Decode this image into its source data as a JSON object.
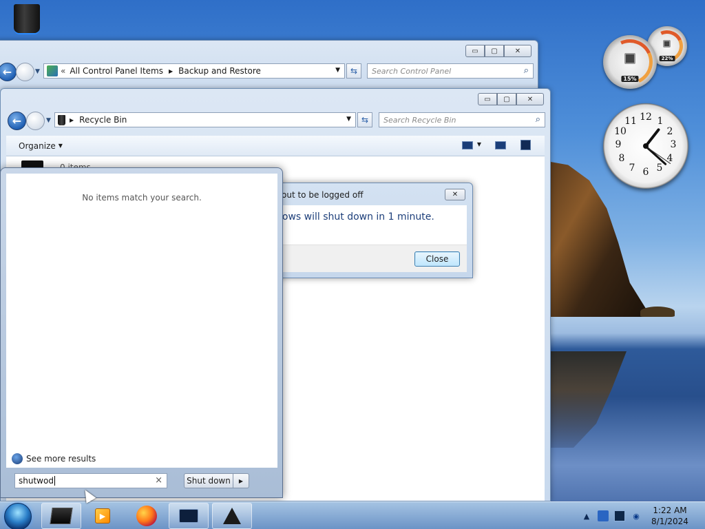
{
  "backup_window": {
    "breadcrumb": [
      "All Control Panel Items",
      "Backup and Restore"
    ],
    "search_placeholder": "Search Control Panel"
  },
  "recycle_window": {
    "breadcrumb": "Recycle Bin",
    "search_placeholder": "Search Recycle Bin",
    "organize_label": "Organize",
    "item_count": "0 items"
  },
  "dialog": {
    "title": "out to be logged off",
    "message": "dows will shut down in 1 minute.",
    "close_label": "Close"
  },
  "start_menu": {
    "no_match": "No items match your search.",
    "see_more": "See more results",
    "search_value": "shutwod",
    "shutdown_label": "Shut down"
  },
  "gadgets": {
    "cpu_percent": "15%",
    "ram_percent": "22%",
    "clock_numbers": [
      "12",
      "1",
      "2",
      "3",
      "4",
      "5",
      "6",
      "7",
      "8",
      "9",
      "10",
      "11"
    ]
  },
  "taskbar": {
    "time": "1:22 AM",
    "date": "8/1/2024"
  },
  "caption_glyphs": {
    "minimize": "▭",
    "maximize": "▢",
    "close": "✕"
  }
}
